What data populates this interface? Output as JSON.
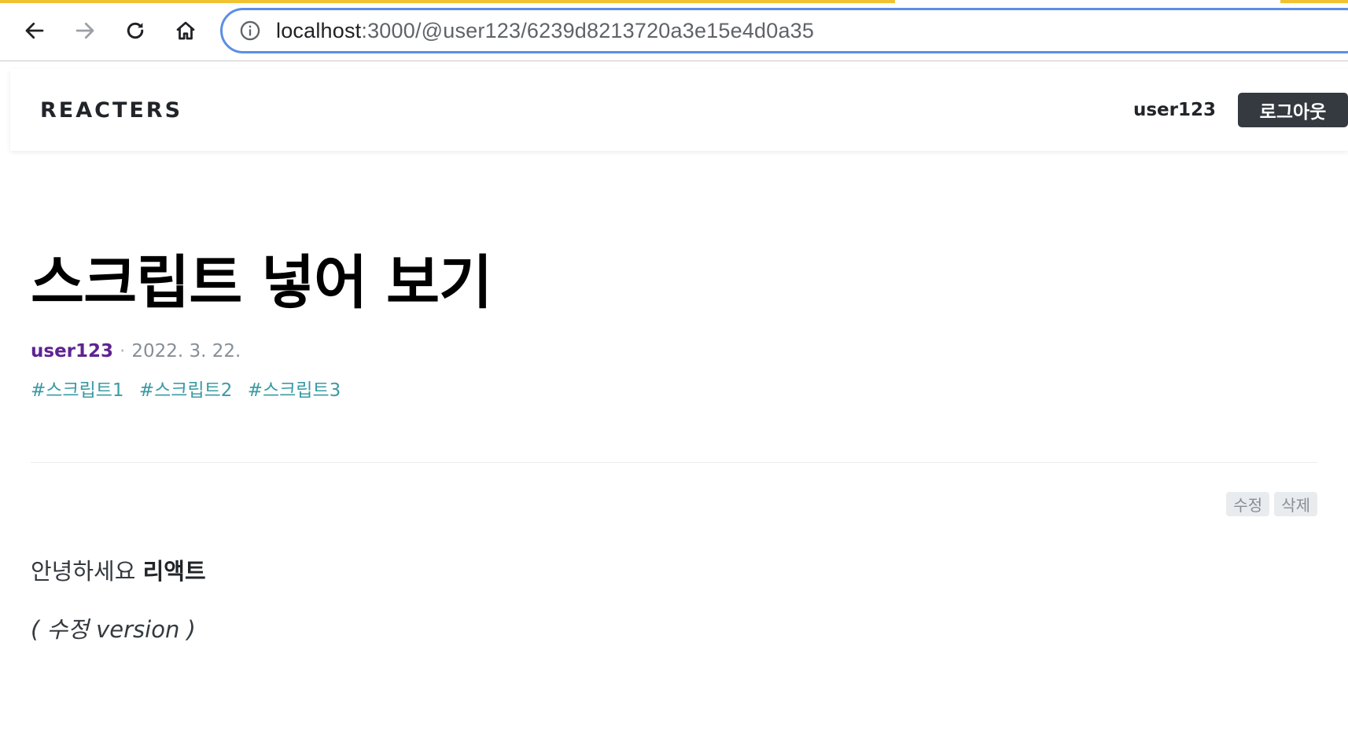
{
  "browser": {
    "url_host": "localhost",
    "url_path": ":3000/@user123/6239d8213720a3e15e4d0a35"
  },
  "header": {
    "logo": "REACTERS",
    "username": "user123",
    "logout_label": "로그아웃"
  },
  "post": {
    "title": "스크립트 넣어 보기",
    "author": "user123",
    "separator": "·",
    "date": "2022. 3. 22.",
    "tags": [
      "#스크립트1",
      "#스크립트2",
      "#스크립트3"
    ],
    "actions": {
      "edit_label": "수정",
      "delete_label": "삭제"
    },
    "body": {
      "line1_plain": "안녕하세요 ",
      "line1_bold": "리액트",
      "line2": "( 수정 version )"
    }
  },
  "colors": {
    "author": "#5f2390",
    "tag": "#3a9ba3",
    "logout_bg": "#343a40",
    "omnibox_border": "#5b8ee6",
    "loading_strip": "#f1c232"
  },
  "icons": {
    "back": "arrow-left",
    "forward": "arrow-right",
    "reload": "reload",
    "home": "home",
    "site_info": "info-circle"
  }
}
